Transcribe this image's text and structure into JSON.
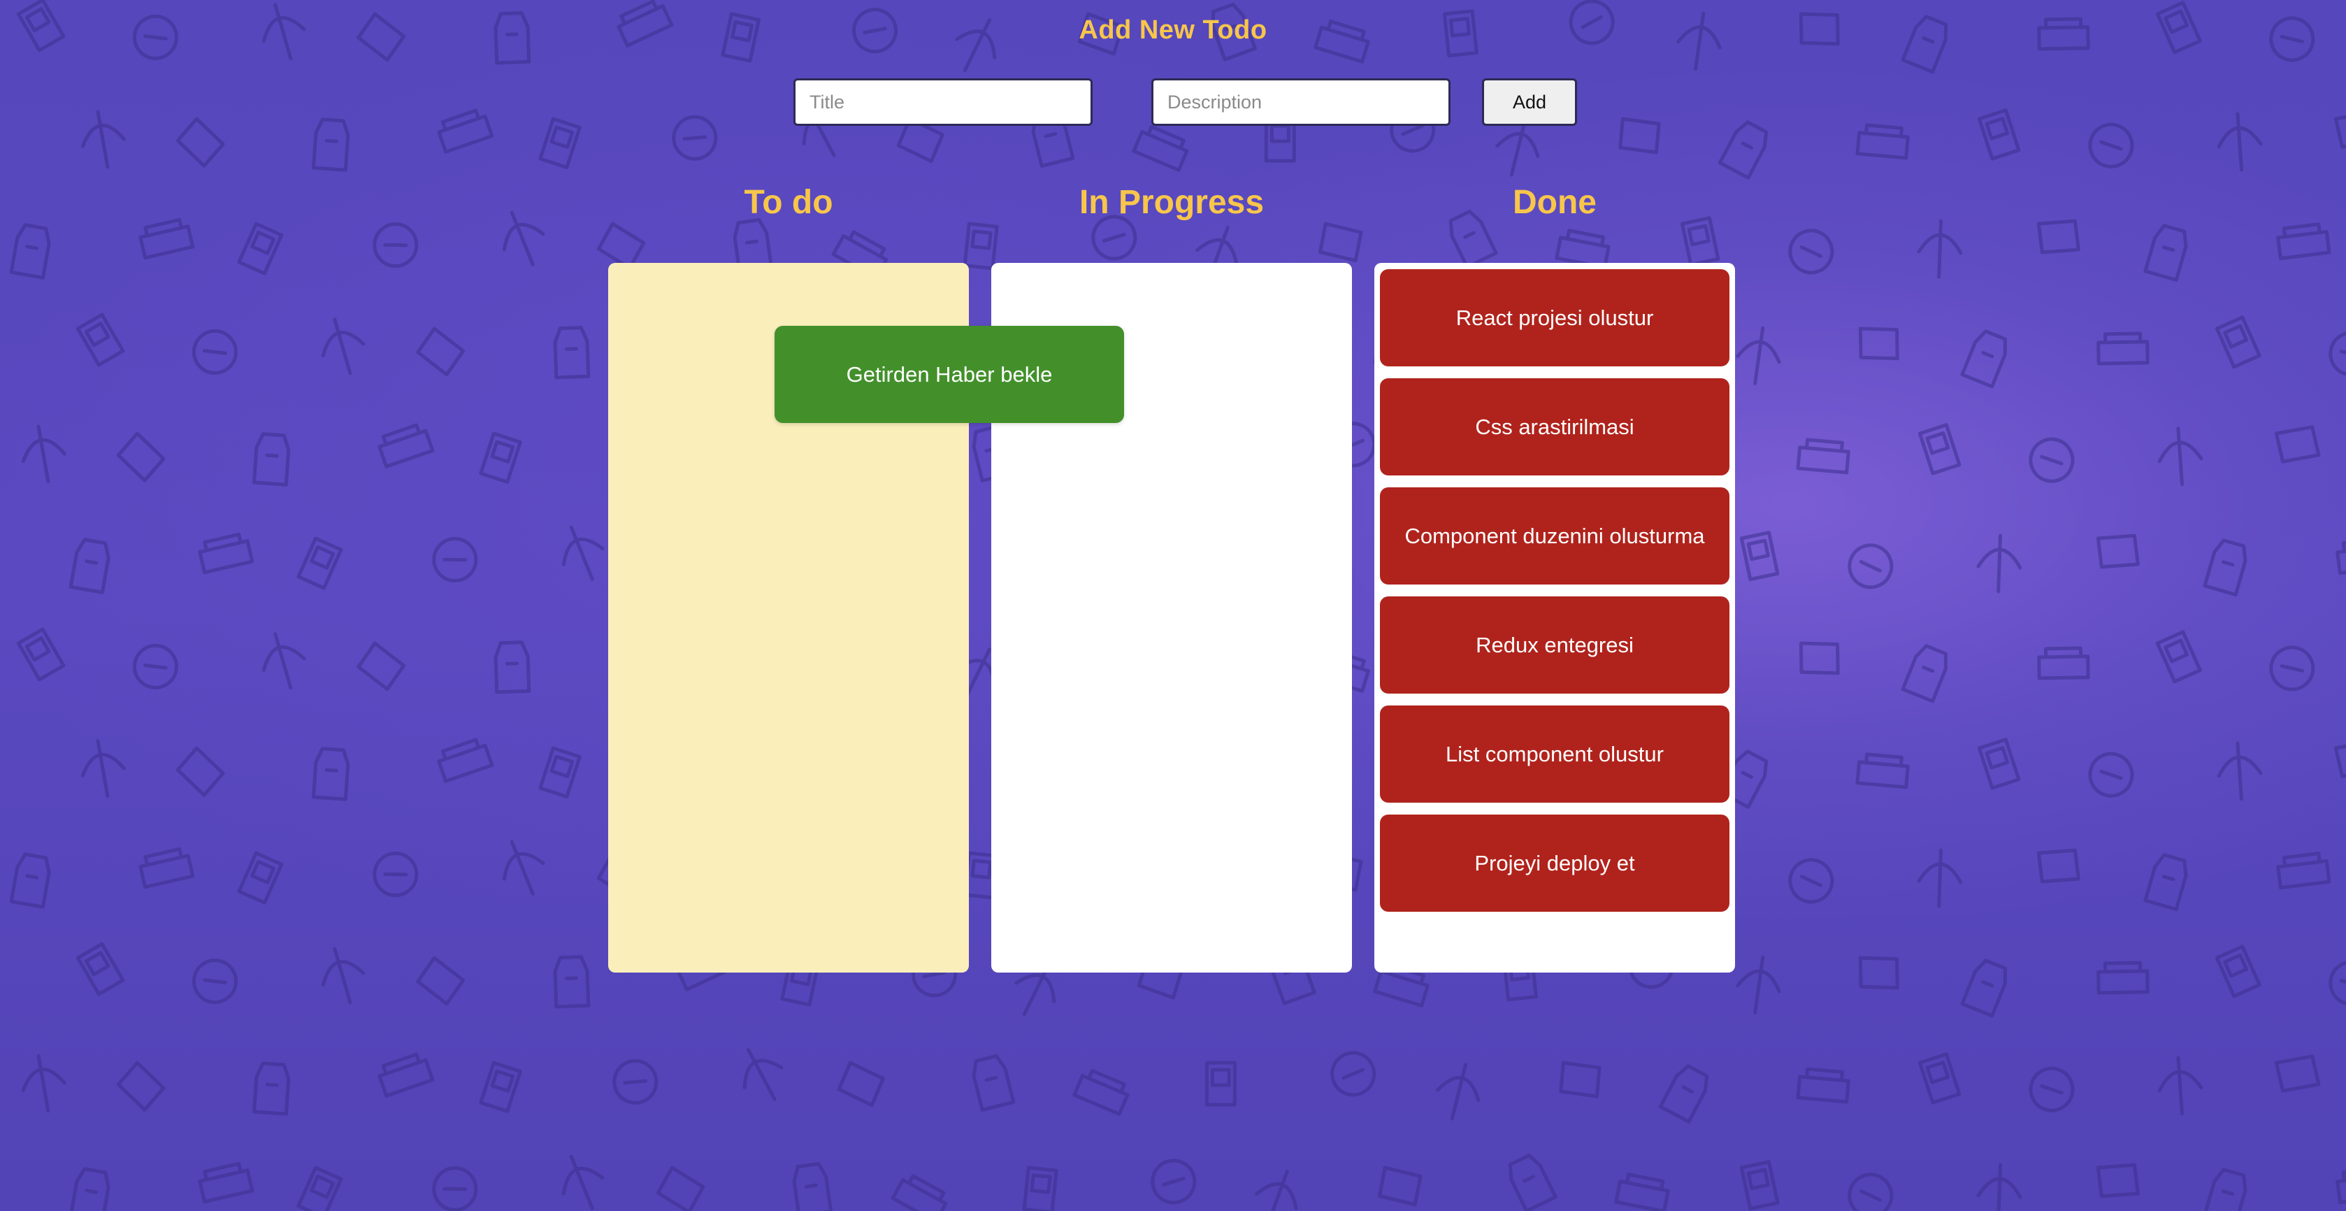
{
  "header": {
    "title": "Add New Todo"
  },
  "form": {
    "title_placeholder": "Title",
    "description_placeholder": "Description",
    "add_label": "Add"
  },
  "columns": [
    {
      "heading": "To do",
      "cards": []
    },
    {
      "heading": "In Progress",
      "cards": []
    },
    {
      "heading": "Done",
      "cards": [
        {
          "title": "React projesi olustur"
        },
        {
          "title": "Css arastirilmasi"
        },
        {
          "title": "Component duzenini olusturma"
        },
        {
          "title": "Redux entegresi"
        },
        {
          "title": "List component olustur"
        },
        {
          "title": "Projeyi deploy et"
        }
      ]
    }
  ],
  "dragging_card": {
    "title": "Getirden Haber bekle"
  },
  "colors": {
    "background": "#5445b8",
    "accent_text": "#f7c64b",
    "todo_column": "#faefbb",
    "done_card": "#b0231c",
    "dragging_card": "#43902b"
  }
}
